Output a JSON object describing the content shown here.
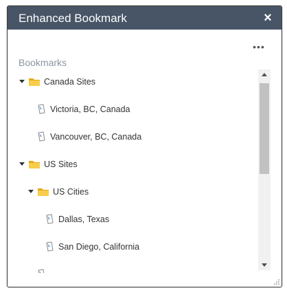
{
  "window": {
    "title": "Enhanced Bookmark",
    "close_label": "×",
    "more_label": "•••"
  },
  "section_label": "Bookmarks",
  "tree": {
    "canada": {
      "label": "Canada Sites",
      "expanded": true
    },
    "victoria": {
      "label": "Victoria, BC, Canada"
    },
    "vancouver": {
      "label": "Vancouver, BC, Canada"
    },
    "us": {
      "label": "US Sites",
      "expanded": true
    },
    "us_cities": {
      "label": "US Cities",
      "expanded": true
    },
    "dallas": {
      "label": "Dallas, Texas"
    },
    "san_diego": {
      "label": "San Diego, California"
    }
  },
  "colors": {
    "titlebar": "#485566",
    "folder": "#f5c342",
    "section_label": "#8a96a3"
  },
  "icons": [
    "close-icon",
    "more-options-icon",
    "caret-down-icon",
    "folder-icon",
    "bookmark-icon",
    "scroll-up-icon",
    "scroll-down-icon",
    "resize-grip-icon"
  ]
}
